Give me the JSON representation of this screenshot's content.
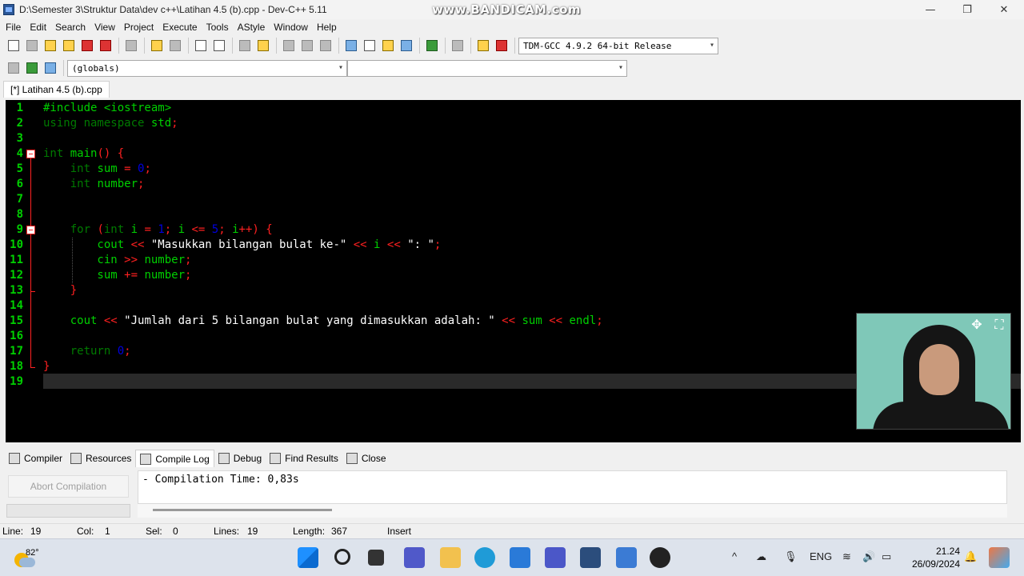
{
  "window": {
    "title": "D:\\Semester 3\\Struktur Data\\dev c++\\Latihan 4.5 (b).cpp - Dev-C++ 5.11",
    "watermark": "www.BANDICAM.com",
    "controls": {
      "minimize": "—",
      "maximize": "❐",
      "close": "✕"
    }
  },
  "menu": [
    "File",
    "Edit",
    "Search",
    "View",
    "Project",
    "Execute",
    "Tools",
    "AStyle",
    "Window",
    "Help"
  ],
  "toolbar": {
    "compiler_select": "TDM-GCC 4.9.2 64-bit Release",
    "scope_select": "(globals)",
    "member_select": ""
  },
  "file_tab": "[*] Latihan 4.5 (b).cpp",
  "editor": {
    "lines": [
      [
        [
          "dir",
          "#include <iostream>"
        ]
      ],
      [
        [
          "kw",
          "using namespace "
        ],
        [
          "id",
          "std"
        ],
        [
          "op",
          ";"
        ]
      ],
      [],
      [
        [
          "kw",
          "int "
        ],
        [
          "id",
          "main"
        ],
        [
          "op",
          "() {"
        ]
      ],
      [
        [
          "id",
          "    "
        ],
        [
          "kw",
          "int "
        ],
        [
          "id",
          "sum "
        ],
        [
          "op",
          "= "
        ],
        [
          "num",
          "0"
        ],
        [
          "op",
          ";"
        ]
      ],
      [
        [
          "id",
          "    "
        ],
        [
          "kw",
          "int "
        ],
        [
          "id",
          "number"
        ],
        [
          "op",
          ";"
        ]
      ],
      [],
      [],
      [
        [
          "id",
          "    "
        ],
        [
          "kw",
          "for "
        ],
        [
          "op",
          "("
        ],
        [
          "kw",
          "int "
        ],
        [
          "id",
          "i "
        ],
        [
          "op",
          "= "
        ],
        [
          "num",
          "1"
        ],
        [
          "op",
          "; "
        ],
        [
          "id",
          "i "
        ],
        [
          "op",
          "<= "
        ],
        [
          "num",
          "5"
        ],
        [
          "op",
          "; "
        ],
        [
          "id",
          "i"
        ],
        [
          "op",
          "++) {"
        ]
      ],
      [
        [
          "id",
          "        cout "
        ],
        [
          "op",
          "<< "
        ],
        [
          "str",
          "\"Masukkan bilangan bulat ke-\" "
        ],
        [
          "op",
          "<< "
        ],
        [
          "id",
          "i "
        ],
        [
          "op",
          "<< "
        ],
        [
          "str",
          "\": \""
        ],
        [
          "op",
          ";"
        ]
      ],
      [
        [
          "id",
          "        cin "
        ],
        [
          "op",
          ">> "
        ],
        [
          "id",
          "number"
        ],
        [
          "op",
          ";"
        ]
      ],
      [
        [
          "id",
          "        sum "
        ],
        [
          "op",
          "+= "
        ],
        [
          "id",
          "number"
        ],
        [
          "op",
          ";"
        ]
      ],
      [
        [
          "id",
          "    "
        ],
        [
          "op",
          "}"
        ]
      ],
      [],
      [
        [
          "id",
          "    cout "
        ],
        [
          "op",
          "<< "
        ],
        [
          "str",
          "\"Jumlah dari 5 bilangan bulat yang dimasukkan adalah: \" "
        ],
        [
          "op",
          "<< "
        ],
        [
          "id",
          "sum "
        ],
        [
          "op",
          "<< "
        ],
        [
          "id",
          "endl"
        ],
        [
          "op",
          ";"
        ]
      ],
      [],
      [
        [
          "id",
          "    "
        ],
        [
          "kw",
          "return "
        ],
        [
          "num",
          "0"
        ],
        [
          "op",
          ";"
        ]
      ],
      [
        [
          "op",
          "}"
        ]
      ],
      []
    ]
  },
  "bottom_tabs": [
    "Compiler",
    "Resources",
    "Compile Log",
    "Debug",
    "Find Results",
    "Close"
  ],
  "abort_button": "Abort Compilation",
  "compile_log": "- Compilation Time: 0,83s",
  "statusbar": {
    "line_label": "Line:",
    "line_value": "19",
    "col_label": "Col:",
    "col_value": "1",
    "sel_label": "Sel:",
    "sel_value": "0",
    "lines_label": "Lines:",
    "lines_value": "19",
    "length_label": "Length:",
    "length_value": "367",
    "mode": "Insert"
  },
  "taskbar": {
    "temperature": "82°",
    "lang": "ENG",
    "time": "21.24",
    "date": "26/09/2024"
  },
  "colors": {
    "editor_bg": "#000000",
    "code_green": "#00d000",
    "keyword_green": "#007a00",
    "number_blue": "#0000e0",
    "operator_red": "#ff2020",
    "string_white": "#ffffff"
  }
}
